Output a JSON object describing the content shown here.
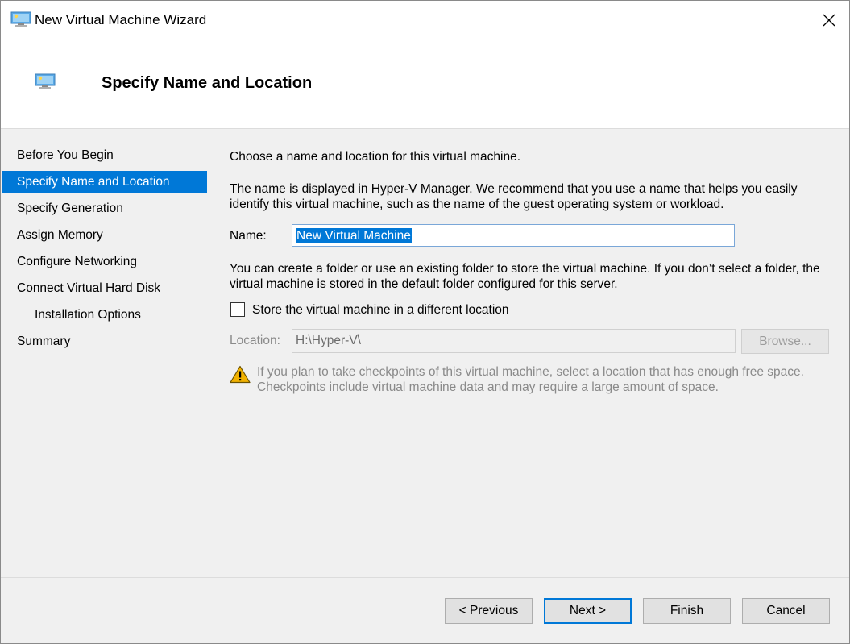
{
  "window": {
    "title": "New Virtual Machine Wizard",
    "icon": "monitor-icon"
  },
  "header": {
    "title": "Specify Name and Location",
    "icon": "monitor-icon"
  },
  "nav": {
    "items": [
      {
        "label": "Before You Begin",
        "active": false,
        "sub": false
      },
      {
        "label": "Specify Name and Location",
        "active": true,
        "sub": false
      },
      {
        "label": "Specify Generation",
        "active": false,
        "sub": false
      },
      {
        "label": "Assign Memory",
        "active": false,
        "sub": false
      },
      {
        "label": "Configure Networking",
        "active": false,
        "sub": false
      },
      {
        "label": "Connect Virtual Hard Disk",
        "active": false,
        "sub": false
      },
      {
        "label": "Installation Options",
        "active": false,
        "sub": true
      },
      {
        "label": "Summary",
        "active": false,
        "sub": false
      }
    ]
  },
  "main": {
    "intro": "Choose a name and location for this virtual machine.",
    "description": "The name is displayed in Hyper-V Manager. We recommend that you use a name that helps you easily identify this virtual machine, such as the name of the guest operating system or workload.",
    "name_label": "Name:",
    "name_value": "New Virtual Machine",
    "folder_text": "You can create a folder or use an existing folder to store the virtual machine. If you don’t select a folder, the virtual machine is stored in the default folder configured for this server.",
    "store_checkbox_label": "Store the virtual machine in a different location",
    "store_checked": false,
    "location_label": "Location:",
    "location_value": "H:\\Hyper-V\\",
    "browse_label": "Browse...",
    "warning_text": "If you plan to take checkpoints of this virtual machine, select a location that has enough free space. Checkpoints include virtual machine data and may require a large amount of space."
  },
  "footer": {
    "previous_label": "< Previous",
    "next_label": "Next >",
    "finish_label": "Finish",
    "cancel_label": "Cancel"
  },
  "colors": {
    "accent": "#0078d7",
    "warning": "#f2b200"
  }
}
